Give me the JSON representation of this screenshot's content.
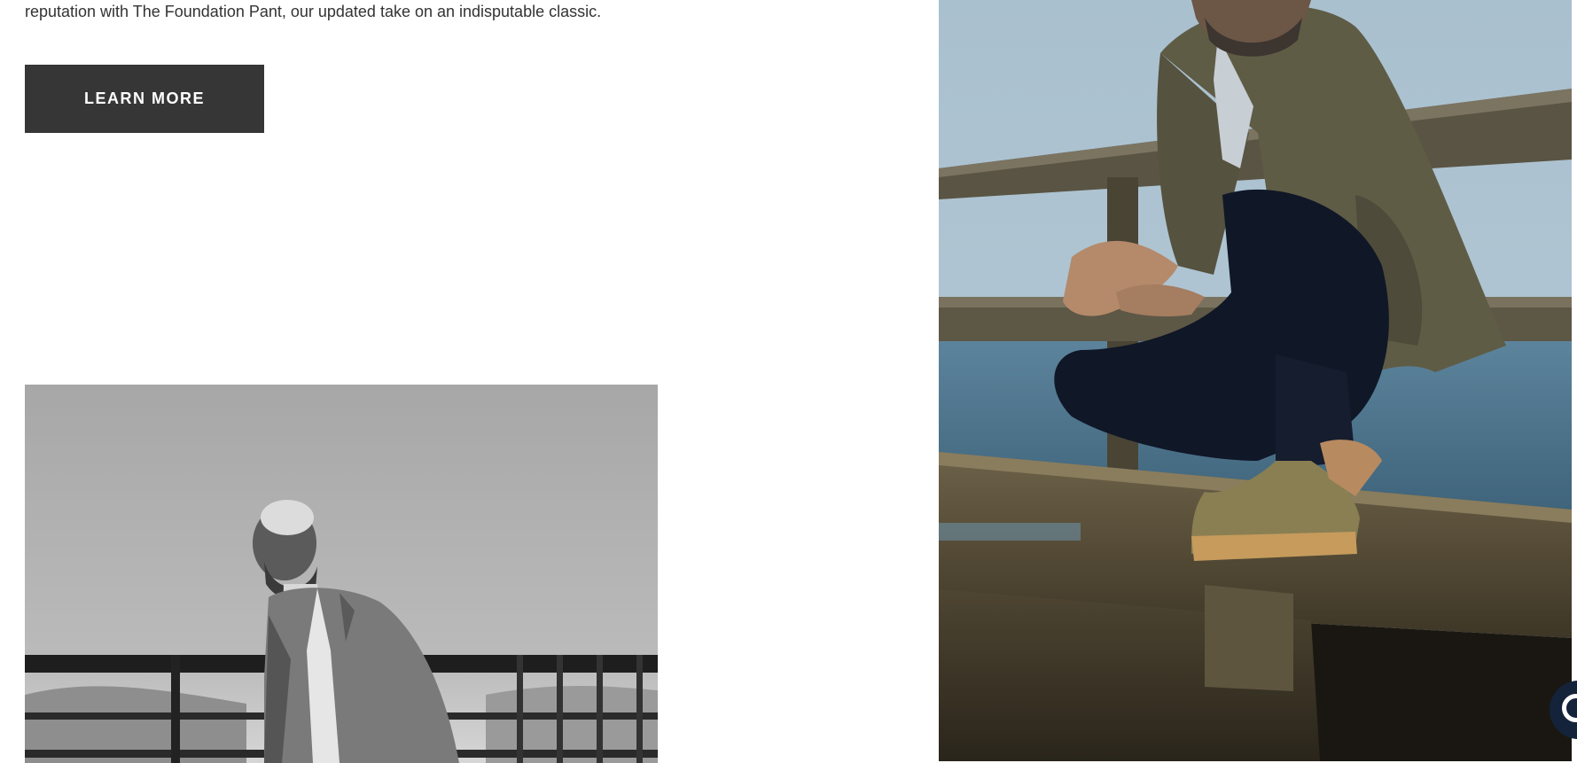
{
  "intro": {
    "text": "reputation with The Foundation Pant, our updated take on an indisputable classic."
  },
  "cta": {
    "label": "LEARN MORE"
  },
  "images": {
    "bw_photo": "photo-bw-man-on-pier",
    "color_photo": "photo-color-man-crouching-on-railing"
  },
  "chat": {
    "icon": "chat-icon"
  },
  "colors": {
    "button_bg": "#363636",
    "text": "#333333",
    "chat_bg": "#14233a"
  }
}
